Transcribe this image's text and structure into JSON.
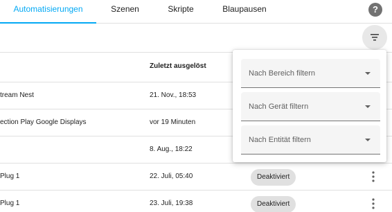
{
  "tabs": [
    {
      "label": "Automatisierungen",
      "active": true
    },
    {
      "label": "Szenen",
      "active": false
    },
    {
      "label": "Skripte",
      "active": false
    },
    {
      "label": "Blaupausen",
      "active": false
    }
  ],
  "help": {
    "icon": "help-circle-icon",
    "glyph": "?"
  },
  "toolbar": {
    "filter_icon": "filter-icon"
  },
  "table": {
    "columns": {
      "last_triggered": "Zuletzt ausgelöst"
    },
    "rows": [
      {
        "name": "tream Nest",
        "last_triggered": "21. Nov., 18:53",
        "status": ""
      },
      {
        "name": "ection Play Google Displays",
        "last_triggered": "vor 19 Minuten",
        "status": ""
      },
      {
        "name": "",
        "last_triggered": "8. Aug., 18:22",
        "status": ""
      },
      {
        "name": "Plug 1",
        "last_triggered": "22. Juli, 05:40",
        "status": "Deaktiviert"
      },
      {
        "name": "Plug 1",
        "last_triggered": "23. Juli, 19:38",
        "status": "Deaktiviert"
      }
    ]
  },
  "filters": [
    {
      "label": "Nach Bereich filtern"
    },
    {
      "label": "Nach Gerät filtern"
    },
    {
      "label": "Nach Entität filtern"
    }
  ],
  "colors": {
    "accent": "#03a9f4",
    "badge_bg": "#e0e0e0",
    "panel_bg": "#ffffff"
  }
}
